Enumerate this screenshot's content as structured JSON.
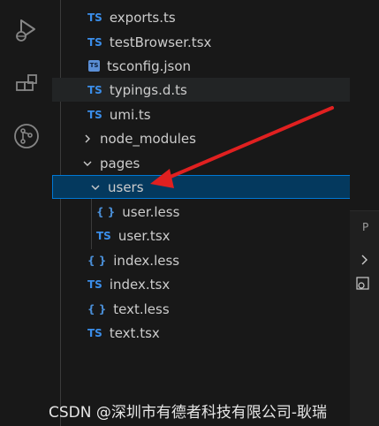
{
  "activity_bar": {
    "icons": [
      "run-debug-icon",
      "extensions-icon",
      "source-control-icon"
    ]
  },
  "explorer": {
    "rows": [
      {
        "icon": "TS",
        "label": "exports.ts"
      },
      {
        "icon": "TS",
        "label": "testBrowser.tsx"
      },
      {
        "icon": "TS",
        "label": "tsconfig.json"
      },
      {
        "icon": "TS",
        "label": "typings.d.ts"
      },
      {
        "icon": "TS",
        "label": "umi.ts"
      },
      {
        "label": "node_modules"
      },
      {
        "label": "pages"
      },
      {
        "label": "users"
      },
      {
        "icon": "{ }",
        "label": "user.less"
      },
      {
        "icon": "TS",
        "label": "user.tsx"
      },
      {
        "icon": "{ }",
        "label": "index.less"
      },
      {
        "icon": "TS",
        "label": "index.tsx"
      },
      {
        "icon": "{ }",
        "label": "text.less"
      },
      {
        "icon": "TS",
        "label": "text.tsx"
      }
    ]
  },
  "right_panel": {
    "tab_label": "P"
  },
  "annotation": {
    "arrow_color": "#e02020"
  },
  "watermark": {
    "text": "CSDN @深圳市有德者科技有限公司-耿瑞"
  }
}
